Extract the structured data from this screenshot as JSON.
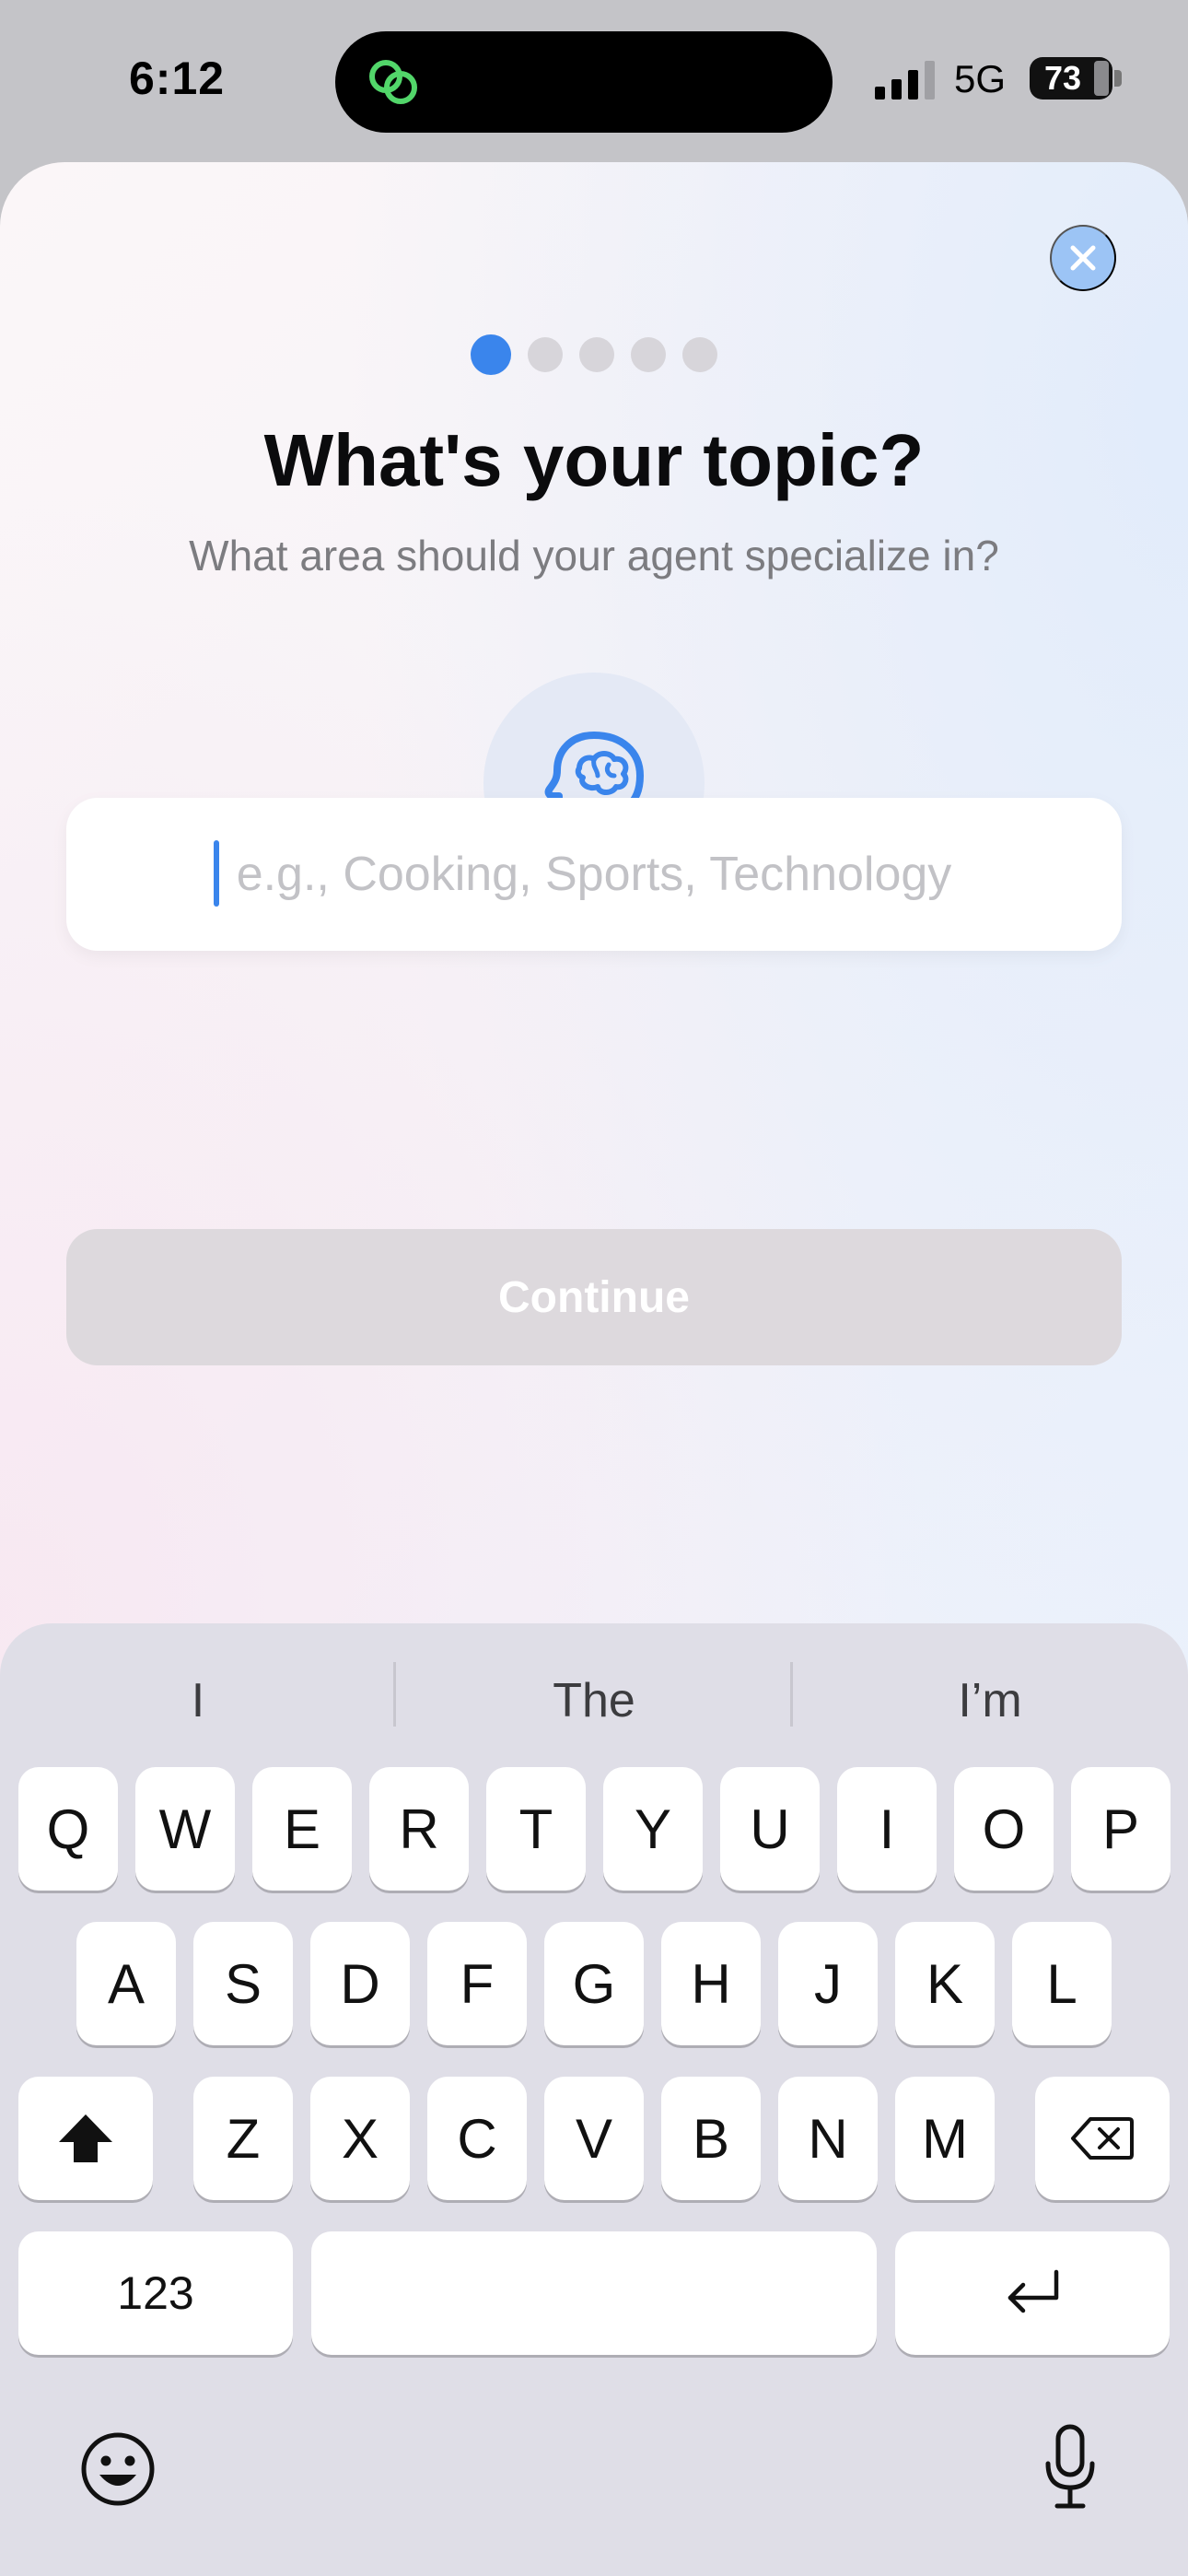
{
  "status_bar": {
    "time": "6:12",
    "network": "5G",
    "battery": "73"
  },
  "sheet": {
    "close_icon": "close-icon",
    "steps_total": 5,
    "step_current": 1,
    "title": "What's your topic?",
    "subtitle": "What area should your agent specialize in?",
    "hero_icon": "brain-head-icon",
    "topic_input": {
      "value": "",
      "placeholder": "e.g., Cooking, Sports, Technology"
    },
    "continue_label": "Continue"
  },
  "keyboard": {
    "suggestions": [
      "I",
      "The",
      "I’m"
    ],
    "row1": [
      "Q",
      "W",
      "E",
      "R",
      "T",
      "Y",
      "U",
      "I",
      "O",
      "P"
    ],
    "row2": [
      "A",
      "S",
      "D",
      "F",
      "G",
      "H",
      "J",
      "K",
      "L"
    ],
    "row3": [
      "Z",
      "X",
      "C",
      "V",
      "B",
      "N",
      "M"
    ],
    "numbers_label": "123",
    "colors": {
      "accent": "#3A85EC",
      "key_bg": "#FFFFFF",
      "keyboard_bg": "#DFDEE7"
    }
  }
}
